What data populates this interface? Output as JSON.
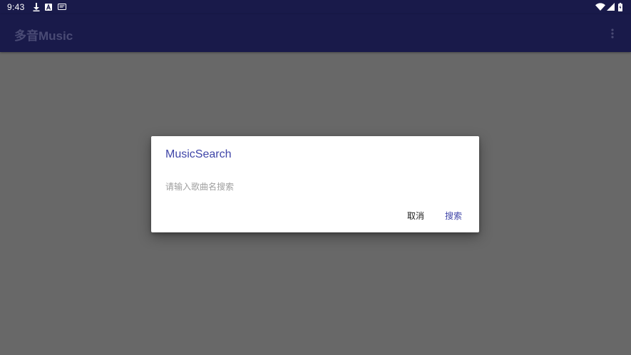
{
  "status_bar": {
    "time": "9:43",
    "left_icons": [
      "download-icon",
      "app-a-icon",
      "app-notification-icon"
    ],
    "right_icons": [
      "wifi-icon",
      "signal-icon",
      "battery-icon"
    ]
  },
  "app_bar": {
    "title": "多音Music",
    "overflow_icon": "more-vert-icon"
  },
  "dialog": {
    "title": "MusicSearch",
    "input_placeholder": "请输入歌曲名搜索",
    "input_value": "",
    "cancel_label": "取消",
    "search_label": "搜索"
  },
  "colors": {
    "app_bar": "#191a4a",
    "scrim_background": "#686868",
    "accent": "#3f45a8",
    "dialog_background": "#ffffff"
  }
}
